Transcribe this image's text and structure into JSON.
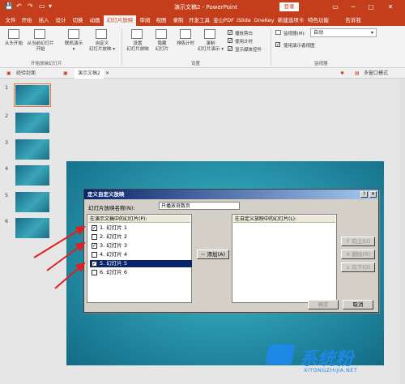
{
  "title_bar": {
    "doc_title": "演示文稿2 - PowerPoint",
    "login": "登录",
    "quick_access": [
      "💾",
      "↶",
      "↷",
      "▭",
      "▾"
    ],
    "window_buttons": [
      "▭",
      "─",
      "▢",
      "✕"
    ]
  },
  "ribbon_tabs": [
    "文件",
    "开始",
    "插入",
    "设计",
    "切换",
    "动画",
    "幻灯片放映",
    "审阅",
    "视图",
    "录制",
    "开发工具",
    "金山PDF",
    "iSlide",
    "OneKey",
    "新建选项卡",
    "特色功能",
    "告诉我"
  ],
  "ribbon": {
    "from_start": "从头开始",
    "from_current_line1": "从当前幻灯片",
    "from_current_line2": "开始",
    "online_present_line1": "联机演示",
    "online_present_line2": "▾",
    "custom_show_line1": "自定义",
    "custom_show_line2": "幻灯片放映 ▾",
    "group_start": "开始放映幻灯片",
    "setup_show_line1": "设置",
    "setup_show_line2": "幻灯片放映",
    "hide_slide_line1": "隐藏",
    "hide_slide_line2": "幻灯片",
    "rehearse": "排练计时",
    "record_line1": "录制",
    "record_line2": "幻灯片演示 ▾",
    "play_narrations": "播放旁白",
    "use_timings": "使用计时",
    "show_media_controls": "显示媒体控件",
    "group_setup": "设置",
    "monitor_label": "监视器(M):",
    "monitor_value": "自动",
    "presenter_view": "使用演示者视图",
    "group_monitors": "监视器"
  },
  "doc_tabs": {
    "tab1": "经验封面",
    "tab2": "演示文稿2",
    "multi_window": "多窗口模式"
  },
  "thumbnails": [
    "1",
    "2",
    "3",
    "4",
    "5",
    "6"
  ],
  "dialog": {
    "title": "定义自定义放映",
    "name_label": "幻灯片放映名称(N):",
    "name_value": "只播放奇数页",
    "left_header": "在演示文稿中的幻灯片(P):",
    "right_header": "在自定义放映中的幻灯片(L):",
    "slides": [
      {
        "label": "1. 幻灯片 1",
        "checked": true,
        "selected": false
      },
      {
        "label": "2. 幻灯片 2",
        "checked": false,
        "selected": false
      },
      {
        "label": "3. 幻灯片 3",
        "checked": true,
        "selected": false
      },
      {
        "label": "4. 幻灯片 4",
        "checked": false,
        "selected": false
      },
      {
        "label": "5. 幻灯片 5",
        "checked": true,
        "selected": true
      },
      {
        "label": "6. 幻灯片 6",
        "checked": false,
        "selected": false
      }
    ],
    "add_button": "添加(A)",
    "up_button": "向上(U)",
    "delete_button": "删除(R)",
    "down_button": "向下(D)",
    "ok_button": "确定",
    "cancel_button": "取消"
  },
  "watermark": {
    "brand": "系统粉",
    "site": "XITONGZHIJIA.NET"
  },
  "colors": {
    "accent": "#c43e1c",
    "dialog_title": "#0a246a",
    "arrow": "#e02020"
  }
}
